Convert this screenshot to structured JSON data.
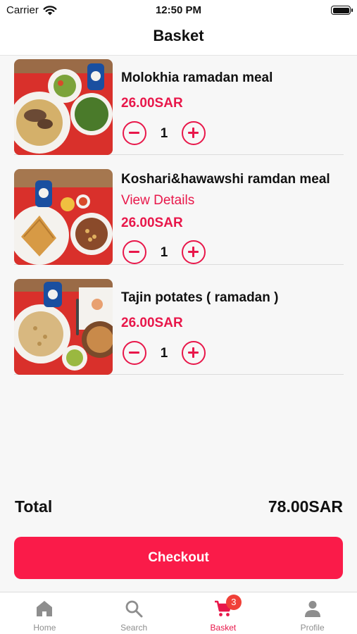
{
  "status_bar": {
    "carrier": "Carrier",
    "time": "12:50 PM"
  },
  "nav": {
    "title": "Basket"
  },
  "items": [
    {
      "name": "Molokhia ramadan meal",
      "link": "",
      "price": "26.00SAR",
      "qty": "1"
    },
    {
      "name": "Koshari&hawawshi ramdan meal",
      "link": "View Details",
      "price": "26.00SAR",
      "qty": "1"
    },
    {
      "name": "Tajin potates ( ramadan )",
      "link": "",
      "price": "26.00SAR",
      "qty": "1"
    }
  ],
  "total": {
    "label": "Total",
    "value": "78.00SAR"
  },
  "checkout": {
    "label": "Checkout"
  },
  "tabs": [
    {
      "label": "Home",
      "icon": "home-icon"
    },
    {
      "label": "Search",
      "icon": "search-icon"
    },
    {
      "label": "Basket",
      "icon": "cart-icon",
      "badge": "3",
      "active": true
    },
    {
      "label": "Profile",
      "icon": "person-icon"
    }
  ],
  "colors": {
    "accent": "#e8174a",
    "checkout": "#fa1b49",
    "badge": "#f04038",
    "inactive_tab": "#8e8e8e"
  }
}
